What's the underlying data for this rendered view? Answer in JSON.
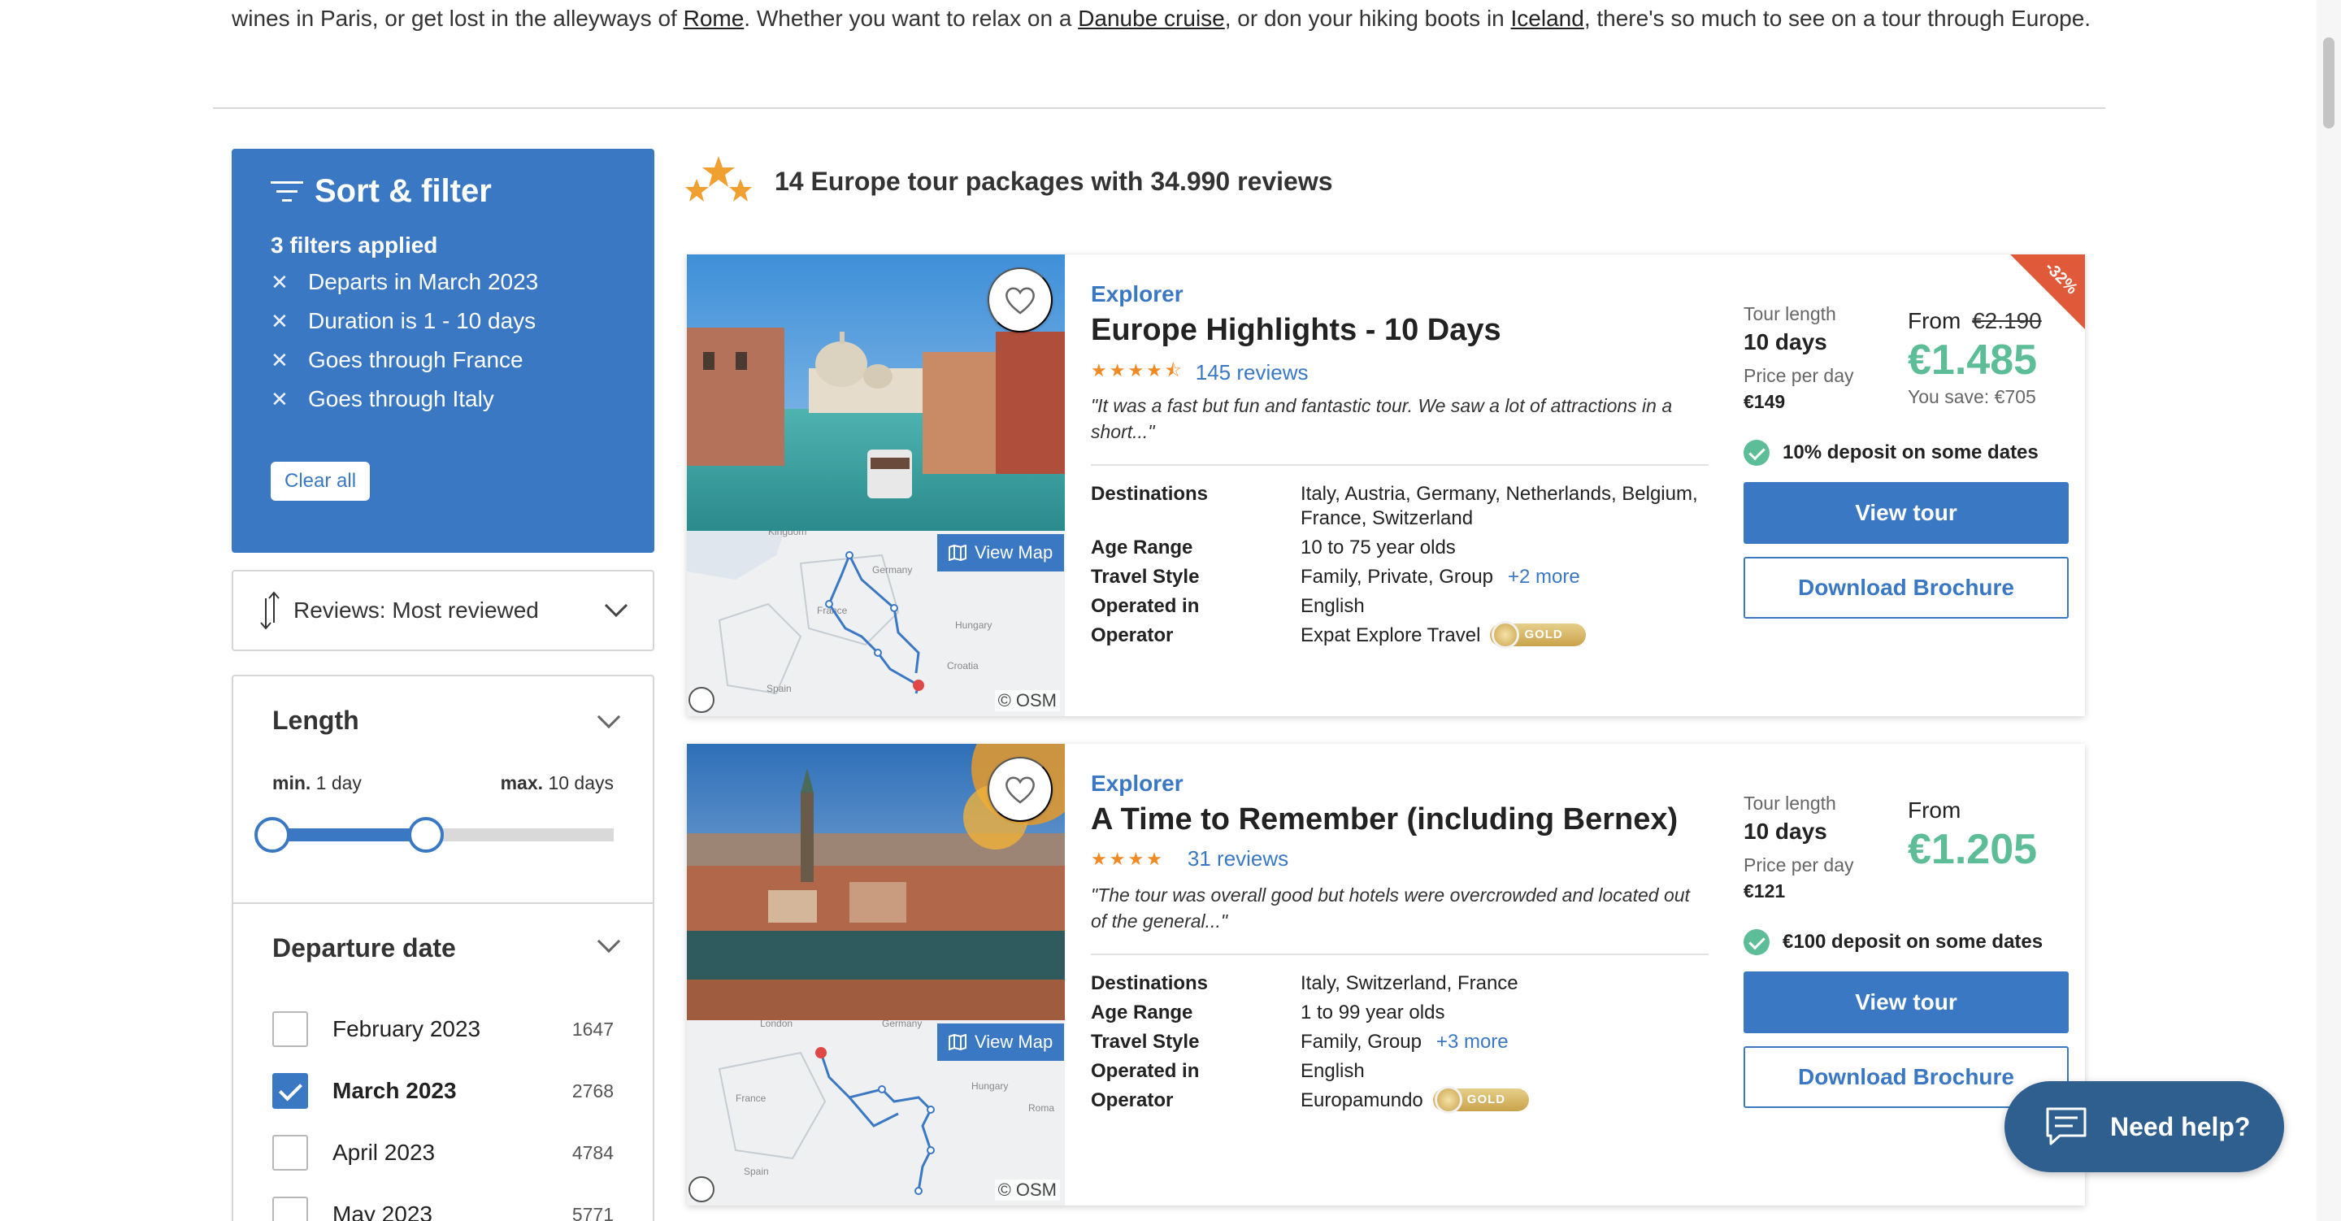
{
  "intro": {
    "part1": "wines in Paris, or get lost in the alleyways of ",
    "link_rome": "Rome",
    "part2": ". Whether you want to relax on a ",
    "link_danube": "Danube cruise",
    "part3": ", or don your hiking boots in ",
    "link_iceland": "Iceland",
    "part4": ", there's so much to see on a tour through Europe."
  },
  "filters": {
    "title": "Sort & filter",
    "applied": "3 filters applied",
    "items": [
      "Departs in March 2023",
      "Duration is 1 - 10 days",
      "Goes through France",
      "Goes through Italy"
    ],
    "clear_label": "Clear all"
  },
  "sort": {
    "label": "Reviews: Most reviewed"
  },
  "length": {
    "title": "Length",
    "min_label": "min.",
    "min_value": "1 day",
    "max_label": "max.",
    "max_value": "10 days",
    "slider_min_fraction": 0.0,
    "slider_max_fraction": 0.45
  },
  "departure": {
    "title": "Departure date",
    "items": [
      {
        "name": "February 2023",
        "count": "1647",
        "checked": false
      },
      {
        "name": "March 2023",
        "count": "2768",
        "checked": true
      },
      {
        "name": "April 2023",
        "count": "4784",
        "checked": false
      },
      {
        "name": "May 2023",
        "count": "5771",
        "checked": false
      }
    ]
  },
  "results": {
    "heading": "14 Europe tour packages with 34.990 reviews"
  },
  "tours": [
    {
      "brand": "Explorer",
      "name": "Europe Highlights - 10 Days",
      "stars": "★★★★⯪",
      "reviews": "145 reviews",
      "quote": "\"It was a fast but fun and fantastic tour. We saw a lot of attractions in a short...\"",
      "view_map": "View Map",
      "osm": "© OSM",
      "destinations_label": "Destinations",
      "destinations": "Italy, Austria, Germany, Netherlands, Belgium, France, Switzerland",
      "age_label": "Age Range",
      "age": "10 to 75 year olds",
      "style_label": "Travel Style",
      "style": "Family, Private, Group",
      "style_more": "+2 more",
      "operated_label": "Operated in",
      "operated": "English",
      "operator_label": "Operator",
      "operator": "Expat Explore Travel",
      "badge": "GOLD",
      "tour_length_label": "Tour length",
      "tour_length": "10 days",
      "ppd_label": "Price per day",
      "ppd": "€149",
      "from_label": "From",
      "old_price": "€2.190",
      "price": "€1.485",
      "save": "You save: €705",
      "deposit": "10% deposit on some dates",
      "discount": "-32%",
      "view_label": "View tour",
      "download_label": "Download Brochure"
    },
    {
      "brand": "Explorer",
      "name": "A Time to Remember (including Bernex)",
      "stars": "★★★★",
      "reviews": "31 reviews",
      "quote": "\"The tour was overall good but hotels were overcrowded and located out of the general...\"",
      "view_map": "View Map",
      "osm": "© OSM",
      "destinations_label": "Destinations",
      "destinations": "Italy, Switzerland, France",
      "age_label": "Age Range",
      "age": "1 to 99 year olds",
      "style_label": "Travel Style",
      "style": "Family, Group",
      "style_more": "+3 more",
      "operated_label": "Operated in",
      "operated": "English",
      "operator_label": "Operator",
      "operator": "Europamundo",
      "badge": "GOLD",
      "tour_length_label": "Tour length",
      "tour_length": "10 days",
      "ppd_label": "Price per day",
      "ppd": "€121",
      "from_label": "From",
      "price": "€1.205",
      "deposit": "€100 deposit on some dates",
      "view_label": "View tour",
      "download_label": "Download Brochure"
    }
  ],
  "help": {
    "label": "Need help?"
  },
  "colors": {
    "primary": "#3b78c4",
    "price_green": "#5dbd98",
    "discount_red": "#e05a3a",
    "help_bg": "#2e5f8f",
    "star_orange": "#f08a24"
  }
}
